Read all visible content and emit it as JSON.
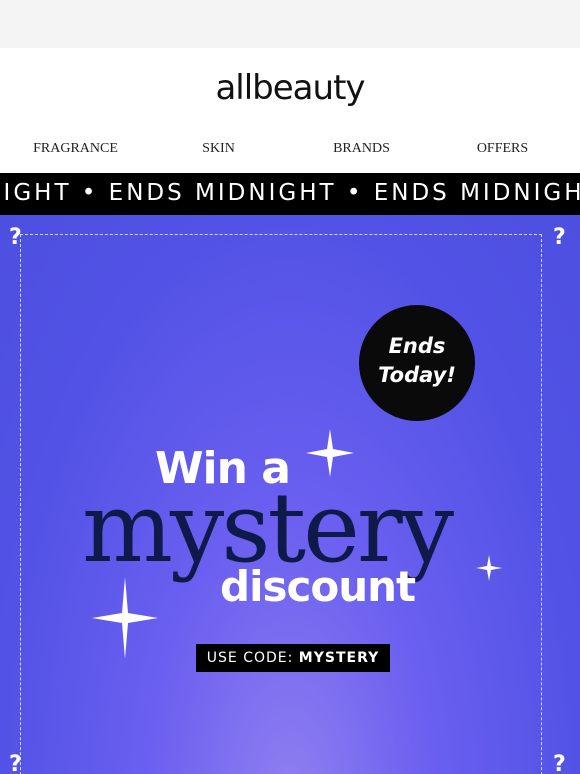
{
  "brand": {
    "logo_text": "allbeauty"
  },
  "nav": {
    "items": [
      {
        "label": "FRAGRANCE"
      },
      {
        "label": "SKIN"
      },
      {
        "label": "BRANDS"
      },
      {
        "label": "OFFERS"
      }
    ]
  },
  "ticker": {
    "text": "MIDNIGHT • ENDS MIDNIGHT • ENDS MIDNIGHT"
  },
  "hero": {
    "badge_line1": "Ends",
    "badge_line2": "Today!",
    "headline_top": "Win a",
    "headline_main": "mystery",
    "headline_bottom": "discount",
    "code_label": "USE CODE: ",
    "code_value": "MYSTERY",
    "corner_mark": "?",
    "colors": {
      "background": "#5253e6",
      "headline_main": "#101a4a",
      "badge": "#0a0a0a"
    }
  }
}
